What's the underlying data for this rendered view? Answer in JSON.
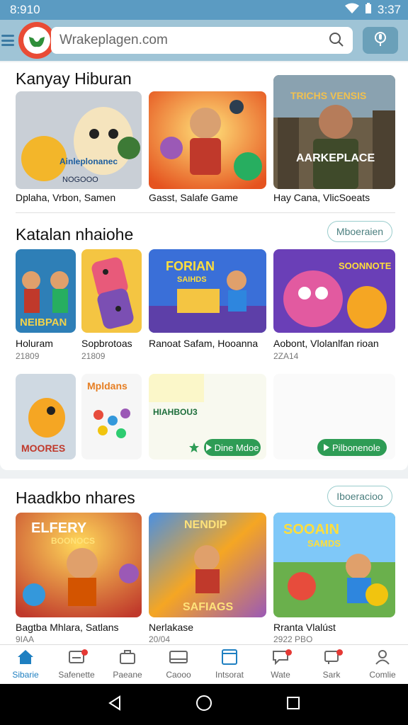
{
  "status": {
    "time": "8:910",
    "clock": "3:37"
  },
  "search": {
    "placeholder": "Wrakeplagen.com"
  },
  "section1": {
    "title": "Kanyay Hiburan",
    "items": [
      {
        "label": "Dplaha, Vrbon, Samen"
      },
      {
        "label": "Gasst, Salafe Game"
      },
      {
        "label": "Hay Cana, VlicSoeats"
      }
    ]
  },
  "section2": {
    "title": "Katalan nhaiohe",
    "more": "Mboeraien",
    "items": [
      {
        "label": "Holuram",
        "meta": "21809"
      },
      {
        "label": "Sopbrotoas",
        "meta": "21809"
      },
      {
        "label": "Ranoat Safam, Hooanna",
        "meta": ""
      },
      {
        "label": "Aobont, Vlolanlfan rioan",
        "meta": "2ZA14"
      }
    ],
    "promo": {
      "text": "HIAHBOU3",
      "cta1": "Dine Mdoe",
      "cta2": "Pilbonenole"
    }
  },
  "section3": {
    "title": "Haadkbo nhares",
    "more": "Iboeracioo",
    "items": [
      {
        "label": "Bagtba Mhlara, Satlans",
        "meta": "9IAA"
      },
      {
        "label": "Nerlakase",
        "meta": "20/04"
      },
      {
        "label": "Rranta Vlalúst",
        "meta": "2922 PBO"
      }
    ]
  },
  "nav": {
    "items": [
      {
        "label": "Sibarie",
        "icon": "home-icon",
        "active": true
      },
      {
        "label": "Safenette",
        "icon": "inbox-icon"
      },
      {
        "label": "Paeane",
        "icon": "briefcase-icon"
      },
      {
        "label": "Caooo",
        "icon": "card-icon"
      },
      {
        "label": "Intsorat",
        "icon": "tablet-icon"
      },
      {
        "label": "Wate",
        "icon": "chat-icon"
      },
      {
        "label": "Sark",
        "icon": "cart-icon"
      },
      {
        "label": "Comlie",
        "icon": "profile-icon"
      }
    ]
  },
  "thumb_texts": {
    "t1": "Ainleplonanec",
    "t1b": "NOGOOO",
    "t3": "TRICHS VENSIS",
    "t3b": "AARKEPLACE",
    "t5": "NEIBPAN",
    "t7": "FORIAN",
    "t7b": "SAIHDS",
    "t8": "SOONNOTE",
    "t9": "MOORES",
    "t10": "Mpldans",
    "t11": "ELFERY",
    "t11b": "BOONOCS",
    "t12": "NENDIP",
    "t12b": "SAFIAGS",
    "t13": "SOOAIN",
    "t13b": "SAMDS"
  },
  "colors": {
    "accent": "#1e7fc1",
    "cta": "#2e9c55",
    "statusbar": "#5b9bc2"
  }
}
